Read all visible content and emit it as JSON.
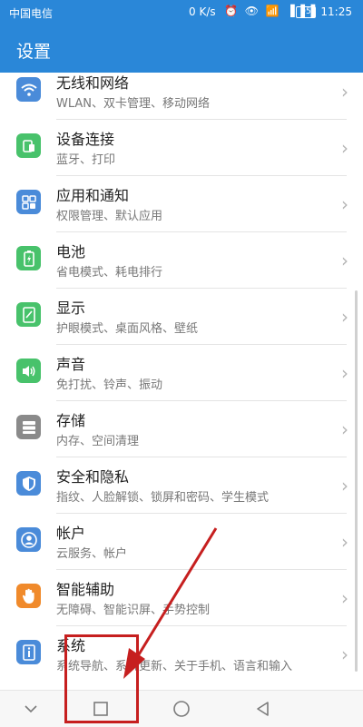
{
  "status": {
    "carrier": "中国电信",
    "speed": "0 K/s",
    "icons": "⏰ 👁 📶 ▐▐▐",
    "battery": "95",
    "time": "11:25"
  },
  "header": {
    "title": "设置"
  },
  "settings": [
    {
      "title": "无线和网络",
      "subtitle": "WLAN、双卡管理、移动网络",
      "icon": "wifi-icon",
      "color": "#4a8bd9"
    },
    {
      "title": "设备连接",
      "subtitle": "蓝牙、打印",
      "icon": "device-connect-icon",
      "color": "#48c26b"
    },
    {
      "title": "应用和通知",
      "subtitle": "权限管理、默认应用",
      "icon": "apps-icon",
      "color": "#4a8bd9"
    },
    {
      "title": "电池",
      "subtitle": "省电模式、耗电排行",
      "icon": "battery-icon",
      "color": "#48c26b"
    },
    {
      "title": "显示",
      "subtitle": "护眼模式、桌面风格、壁纸",
      "icon": "display-icon",
      "color": "#48c26b"
    },
    {
      "title": "声音",
      "subtitle": "免打扰、铃声、振动",
      "icon": "sound-icon",
      "color": "#48c26b"
    },
    {
      "title": "存储",
      "subtitle": "内存、空间清理",
      "icon": "storage-icon",
      "color": "#8a8a8a"
    },
    {
      "title": "安全和隐私",
      "subtitle": "指纹、人脸解锁、锁屏和密码、学生模式",
      "icon": "shield-icon",
      "color": "#4a8bd9"
    },
    {
      "title": "帐户",
      "subtitle": "云服务、帐户",
      "icon": "account-icon",
      "color": "#4a8bd9"
    },
    {
      "title": "智能辅助",
      "subtitle": "无障碍、智能识屏、手势控制",
      "icon": "hand-icon",
      "color": "#f08a2b"
    },
    {
      "title": "系统",
      "subtitle": "系统导航、系统更新、关于手机、语言和输入",
      "icon": "system-icon",
      "color": "#4a8bd9"
    }
  ],
  "navbar": {
    "back": "back-icon",
    "home": "home-icon",
    "recent": "recent-apps-icon",
    "collapse": "collapse-icon"
  },
  "annotation": {
    "color": "#c61f1f"
  }
}
